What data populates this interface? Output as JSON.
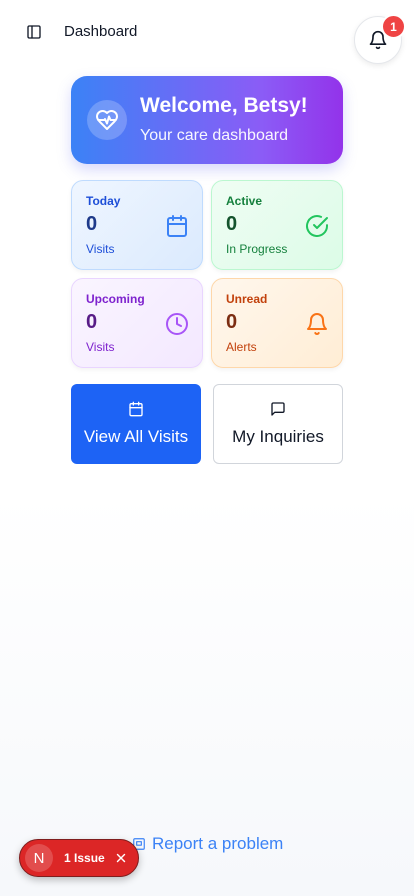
{
  "header": {
    "title": "Dashboard",
    "sidebar_icon": "sidebar-panel-icon",
    "notifications_icon": "bell-icon",
    "notification_count": "1"
  },
  "welcome": {
    "title": "Welcome, Betsy!",
    "subtitle": "Your care dashboard",
    "icon": "heart-pulse-icon"
  },
  "stats": [
    {
      "label": "Today",
      "value": "0",
      "sub": "Visits",
      "icon": "calendar-icon",
      "color": "#3b82f6"
    },
    {
      "label": "Active",
      "value": "0",
      "sub": "In Progress",
      "icon": "check-circle-icon",
      "color": "#22c55e"
    },
    {
      "label": "Upcoming",
      "value": "0",
      "sub": "Visits",
      "icon": "clock-icon",
      "color": "#a855f7"
    },
    {
      "label": "Unread",
      "value": "0",
      "sub": "Alerts",
      "icon": "bell-icon",
      "color": "#f97316"
    }
  ],
  "actions": {
    "visits_label": "View All Visits",
    "visits_icon": "calendar-icon",
    "inquiries_label": "My Inquiries",
    "inquiries_icon": "message-square-icon"
  },
  "footer": {
    "report_label": "Report a problem",
    "report_icon": "flag-icon"
  },
  "dev_overlay": {
    "avatar_letter": "N",
    "issues_label": "1 Issue",
    "close_icon": "close-icon"
  },
  "colors": {
    "primary": "#1d63f5",
    "badge": "#ef4444",
    "issue_pill": "#dc2626"
  }
}
